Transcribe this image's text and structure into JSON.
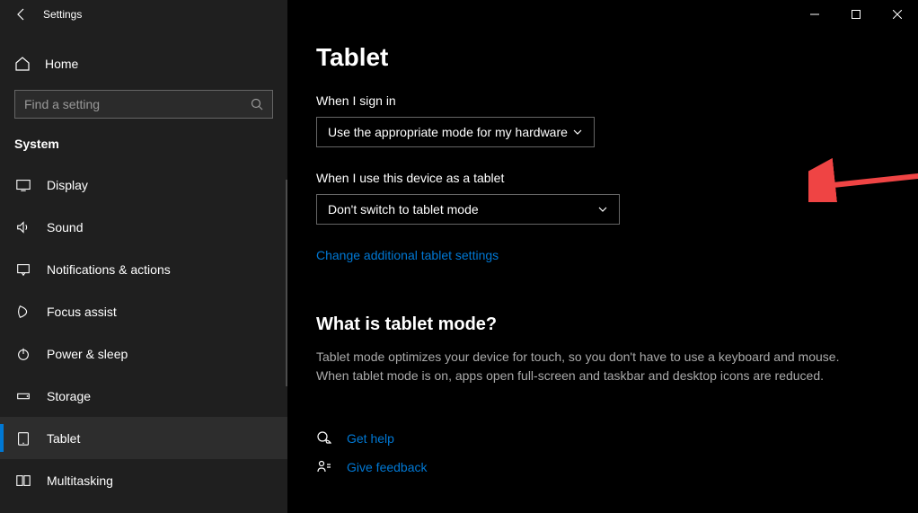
{
  "title": "Settings",
  "home_label": "Home",
  "search_placeholder": "Find a setting",
  "category": "System",
  "nav": [
    {
      "label": "Display"
    },
    {
      "label": "Sound"
    },
    {
      "label": "Notifications & actions"
    },
    {
      "label": "Focus assist"
    },
    {
      "label": "Power & sleep"
    },
    {
      "label": "Storage"
    },
    {
      "label": "Tablet"
    },
    {
      "label": "Multitasking"
    }
  ],
  "page_title": "Tablet",
  "settings": {
    "sign_in_label": "When I sign in",
    "sign_in_value": "Use the appropriate mode for my hardware",
    "device_label": "When I use this device as a tablet",
    "device_value": "Don't switch to tablet mode",
    "additional_link": "Change additional tablet settings"
  },
  "info": {
    "heading": "What is tablet mode?",
    "body": "Tablet mode optimizes your device for touch, so you don't have to use a keyboard and mouse. When tablet mode is on, apps open full-screen and taskbar and desktop icons are reduced."
  },
  "help": {
    "get_help": "Get help",
    "feedback": "Give feedback"
  },
  "colors": {
    "accent": "#0078d4",
    "arrow": "#ef4444"
  }
}
